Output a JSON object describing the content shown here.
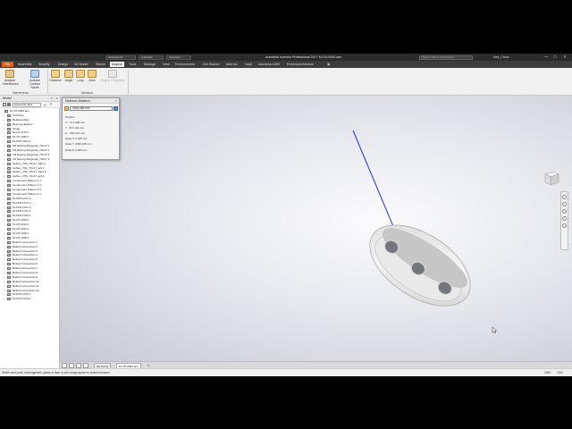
{
  "title_bar": {
    "tabs": [
      "Autodesk.dc",
      "Autodesk",
      "Autodesk"
    ],
    "app_title": "Autodesk Inventor Professional 2017   M-CH-0000.iam",
    "help_search_placeholder": "Search Help & Commands...",
    "user_name": "Neil_Cross",
    "minimize": "—",
    "maximize": "□",
    "close": "×"
  },
  "menu": {
    "file": "File",
    "items": [
      "Assemble",
      "Simplify",
      "Design",
      "3D Model",
      "Sketch",
      "Inspect",
      "Tools",
      "Manage",
      "View",
      "Environments",
      "Get Started",
      "Add-Ins",
      "Vault",
      "Autodesk A360",
      "Electromechanical"
    ],
    "active_index": 5
  },
  "ribbon": {
    "buttons": [
      {
        "label": "Analyze\nInterference",
        "icon": "analyze-interference-icon"
      },
      {
        "label": "Activate\nContact Solver",
        "icon": "contact-solver-icon"
      },
      {
        "label": "Distance",
        "icon": "distance-icon"
      },
      {
        "label": "Angle",
        "icon": "angle-icon"
      },
      {
        "label": "Loop",
        "icon": "loop-icon"
      },
      {
        "label": "Area",
        "icon": "area-icon"
      },
      {
        "label": "Region Properties",
        "icon": "region-properties-icon",
        "disabled": true
      }
    ],
    "panels": [
      "Interference",
      "Measure"
    ]
  },
  "browser": {
    "header": "Model",
    "view_select": "Assembly View",
    "items": [
      {
        "label": "M-CH-0000.iam",
        "depth": 0
      },
      {
        "label": "3rd Party",
        "depth": 1
      },
      {
        "label": "Relationships",
        "depth": 1
      },
      {
        "label": "Representations",
        "depth": 1
      },
      {
        "label": "Origin",
        "depth": 1
      },
      {
        "label": "M-CH-1170:1",
        "depth": 1
      },
      {
        "label": "M-CH-1180:1",
        "depth": 1
      },
      {
        "label": "M-KSH-3194:1",
        "depth": 1
      },
      {
        "label": "OZ Racing Allegerita_70x17:1",
        "depth": 1
      },
      {
        "label": "OZ Racing Allegerita_70x17:2",
        "depth": 1
      },
      {
        "label": "OZ Racing Allegerita_70x17:3",
        "depth": 1
      },
      {
        "label": "OZ Racing Allegerita_70x17:4",
        "depth": 1
      },
      {
        "label": "Isoflex_r70p_70x17_right:1",
        "depth": 1
      },
      {
        "label": "Isoflex_r70p_70x17_left:1",
        "depth": 1
      },
      {
        "label": "Isoflex_r70p_70x17_right:2",
        "depth": 1
      },
      {
        "label": "Isoflex_r70p_70x17_left:2",
        "depth": 1
      },
      {
        "label": "Component Pattern 1:1",
        "depth": 1
      },
      {
        "label": "Component Pattern 2:1",
        "depth": 1
      },
      {
        "label": "Component Pattern 3:1",
        "depth": 1
      },
      {
        "label": "Component Pattern 4:1",
        "depth": 1
      },
      {
        "label": "M-KSH-1071:1",
        "depth": 1
      },
      {
        "label": "M-KSH-1071:2",
        "depth": 1
      },
      {
        "label": "M-KSH-1071:3",
        "depth": 1
      },
      {
        "label": "M-KSH-1071:4",
        "depth": 1
      },
      {
        "label": "M-KSH-1076:1",
        "depth": 1
      },
      {
        "label": "M-CH-1190:1",
        "depth": 1
      },
      {
        "label": "M-CH-1192:1",
        "depth": 1
      },
      {
        "label": "M-CH-1194:1",
        "depth": 1
      },
      {
        "label": "M-CH-1196:1",
        "depth": 1
      },
      {
        "label": "M-CH-1198:1",
        "depth": 1
      },
      {
        "label": "Bolted Connection:1",
        "depth": 1
      },
      {
        "label": "Bolted Connection:2",
        "depth": 1
      },
      {
        "label": "Bolted Connection:3",
        "depth": 1
      },
      {
        "label": "Bolted Connection:4",
        "depth": 1
      },
      {
        "label": "Bolted Connection:5",
        "depth": 1
      },
      {
        "label": "Bolted Connection:6",
        "depth": 1
      },
      {
        "label": "Bolted Connection:7",
        "depth": 1
      },
      {
        "label": "Bolted Connection:8",
        "depth": 1
      },
      {
        "label": "Bolted Connection:9",
        "depth": 1
      },
      {
        "label": "Bolted Connection:10",
        "depth": 1
      },
      {
        "label": "Bolted Connection:11",
        "depth": 1
      },
      {
        "label": "Bolted Connection:12",
        "depth": 1
      },
      {
        "label": "M-KSH-1078:1",
        "depth": 1
      },
      {
        "label": "M-KSH-1079:1",
        "depth": 1
      }
    ]
  },
  "measure_dialog": {
    "title": "Minimum Distance",
    "close": "×",
    "value": "4035.468 mm",
    "lines": [
      "Position",
      "X : -371.495 mm",
      "Y : 517.134 mm",
      "Z : -306.314 mm",
      "Delta X: 0.000 mm",
      "Delta Y: 4035.468 mm",
      "Delta Z: 0.000 mm"
    ]
  },
  "viewcube": {
    "face": "FRONT"
  },
  "doc_tabs": {
    "tabs": [
      "My Home",
      "M-CH-0000.iam"
    ],
    "active_index": 1
  },
  "status": {
    "text": "Select next point, line/edge/axis, plane or face or pick empty space to restart measure",
    "count1": "2484",
    "count2": "1154"
  },
  "colors": {
    "accent": "#e06020",
    "axis_blue": "#2233cc"
  }
}
